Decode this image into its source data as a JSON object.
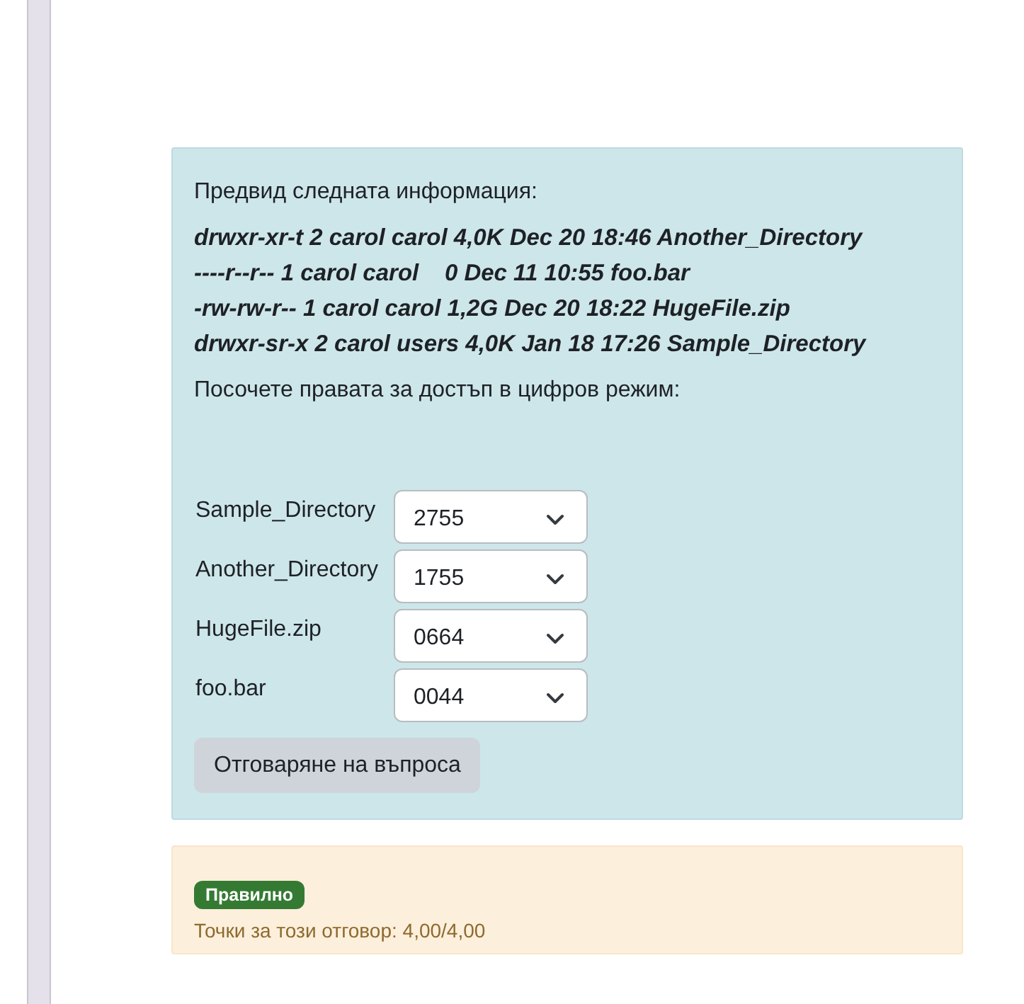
{
  "question": {
    "intro": "Предвид следната информация:",
    "listing": [
      "drwxr-xr-t 2 carol carol 4,0K Dec 20 18:46 Another_Directory",
      "----r--r-- 1 carol carol    0 Dec 11 10:55 foo.bar",
      "-rw-rw-r-- 1 carol carol 1,2G Dec 20 18:22 HugeFile.zip",
      "drwxr-sr-x 2 carol users 4,0K Jan 18 17:26 Sample_Directory"
    ],
    "prompt": "Посочете правата за достъп в цифров режим:",
    "answers": [
      {
        "label": "Sample_Directory",
        "value": "2755"
      },
      {
        "label": "Another_Directory",
        "value": "1755"
      },
      {
        "label": "HugeFile.zip",
        "value": "0664"
      },
      {
        "label": "foo.bar",
        "value": "0044"
      }
    ],
    "submit_button": "Отговаряне на въпроса"
  },
  "feedback": {
    "badge": "Правилно",
    "score": "Точки за този отговор: 4,00/4,00"
  }
}
